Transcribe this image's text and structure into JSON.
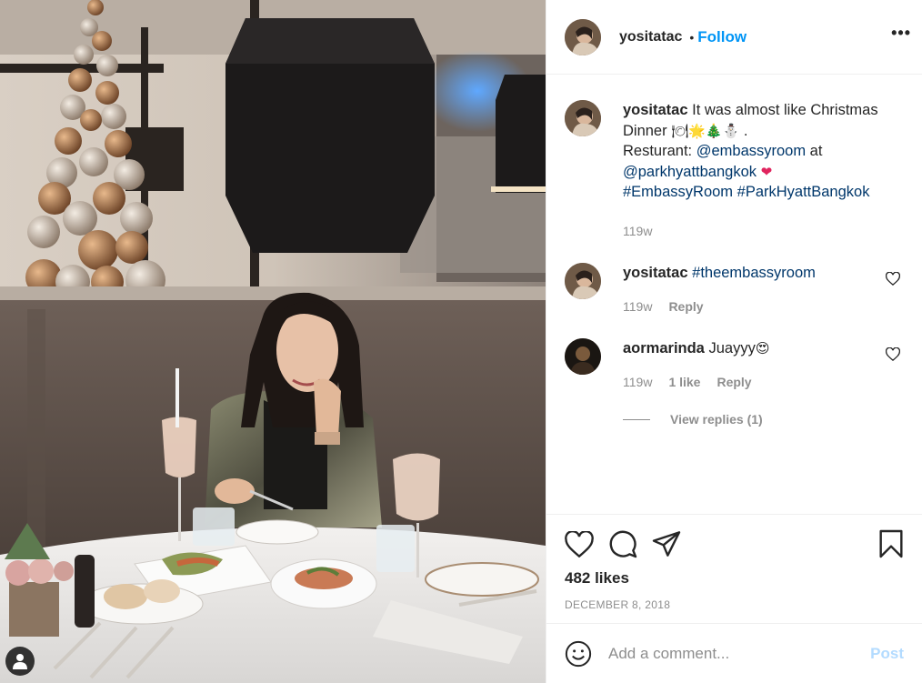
{
  "post": {
    "author": "yositatac",
    "dot": "•",
    "follow_label": "Follow",
    "more_label": "•••"
  },
  "caption": {
    "username": "yositatac",
    "text_1": " It was almost like Christmas Dinner ",
    "emoji_1": "🍽🌟🎄⛄",
    "text_2": " .",
    "line_2_prefix": "Resturant: ",
    "mention_1": "@embassyroom",
    "line_2_suffix": " at",
    "mention_2": "@parkhyattbangkok",
    "heart_emoji": "❤",
    "hashtag_1": "#EmbassyRoom",
    "hashtag_2": "#ParkHyattBangkok",
    "time": "119w"
  },
  "comments": [
    {
      "username": "yositatac",
      "text": "#theembassyroom",
      "time": "119w",
      "reply_label": "Reply"
    },
    {
      "username": "aormarinda",
      "text": "Juayyy",
      "emoji": "😍",
      "time": "119w",
      "likes": "1 like",
      "reply_label": "Reply",
      "view_replies": "View replies (1)"
    }
  ],
  "actions": {
    "icons": [
      "heart-icon",
      "comment-icon",
      "share-icon",
      "bookmark-icon"
    ],
    "likes": "482 likes",
    "date": "DECEMBER 8, 2018"
  },
  "comment_box": {
    "placeholder": "Add a comment...",
    "post_label": "Post"
  },
  "colors": {
    "follow": "#0095f6",
    "link": "#00376b",
    "muted": "#8e8e8e",
    "post_disabled": "#b3dbff"
  }
}
